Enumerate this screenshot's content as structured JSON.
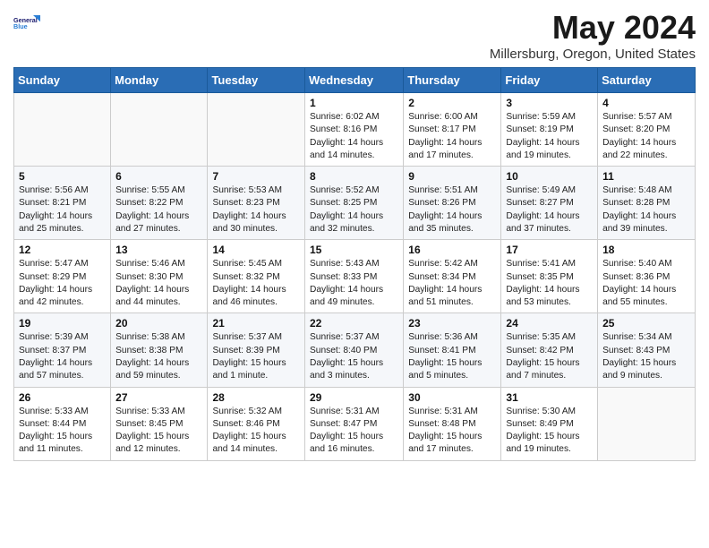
{
  "logo": {
    "line1": "General",
    "line2": "Blue"
  },
  "title": "May 2024",
  "location": "Millersburg, Oregon, United States",
  "days_of_week": [
    "Sunday",
    "Monday",
    "Tuesday",
    "Wednesday",
    "Thursday",
    "Friday",
    "Saturday"
  ],
  "weeks": [
    [
      {
        "day": "",
        "info": ""
      },
      {
        "day": "",
        "info": ""
      },
      {
        "day": "",
        "info": ""
      },
      {
        "day": "1",
        "sunrise": "6:02 AM",
        "sunset": "8:16 PM",
        "daylight": "14 hours and 14 minutes."
      },
      {
        "day": "2",
        "sunrise": "6:00 AM",
        "sunset": "8:17 PM",
        "daylight": "14 hours and 17 minutes."
      },
      {
        "day": "3",
        "sunrise": "5:59 AM",
        "sunset": "8:19 PM",
        "daylight": "14 hours and 19 minutes."
      },
      {
        "day": "4",
        "sunrise": "5:57 AM",
        "sunset": "8:20 PM",
        "daylight": "14 hours and 22 minutes."
      }
    ],
    [
      {
        "day": "5",
        "sunrise": "5:56 AM",
        "sunset": "8:21 PM",
        "daylight": "14 hours and 25 minutes."
      },
      {
        "day": "6",
        "sunrise": "5:55 AM",
        "sunset": "8:22 PM",
        "daylight": "14 hours and 27 minutes."
      },
      {
        "day": "7",
        "sunrise": "5:53 AM",
        "sunset": "8:23 PM",
        "daylight": "14 hours and 30 minutes."
      },
      {
        "day": "8",
        "sunrise": "5:52 AM",
        "sunset": "8:25 PM",
        "daylight": "14 hours and 32 minutes."
      },
      {
        "day": "9",
        "sunrise": "5:51 AM",
        "sunset": "8:26 PM",
        "daylight": "14 hours and 35 minutes."
      },
      {
        "day": "10",
        "sunrise": "5:49 AM",
        "sunset": "8:27 PM",
        "daylight": "14 hours and 37 minutes."
      },
      {
        "day": "11",
        "sunrise": "5:48 AM",
        "sunset": "8:28 PM",
        "daylight": "14 hours and 39 minutes."
      }
    ],
    [
      {
        "day": "12",
        "sunrise": "5:47 AM",
        "sunset": "8:29 PM",
        "daylight": "14 hours and 42 minutes."
      },
      {
        "day": "13",
        "sunrise": "5:46 AM",
        "sunset": "8:30 PM",
        "daylight": "14 hours and 44 minutes."
      },
      {
        "day": "14",
        "sunrise": "5:45 AM",
        "sunset": "8:32 PM",
        "daylight": "14 hours and 46 minutes."
      },
      {
        "day": "15",
        "sunrise": "5:43 AM",
        "sunset": "8:33 PM",
        "daylight": "14 hours and 49 minutes."
      },
      {
        "day": "16",
        "sunrise": "5:42 AM",
        "sunset": "8:34 PM",
        "daylight": "14 hours and 51 minutes."
      },
      {
        "day": "17",
        "sunrise": "5:41 AM",
        "sunset": "8:35 PM",
        "daylight": "14 hours and 53 minutes."
      },
      {
        "day": "18",
        "sunrise": "5:40 AM",
        "sunset": "8:36 PM",
        "daylight": "14 hours and 55 minutes."
      }
    ],
    [
      {
        "day": "19",
        "sunrise": "5:39 AM",
        "sunset": "8:37 PM",
        "daylight": "14 hours and 57 minutes."
      },
      {
        "day": "20",
        "sunrise": "5:38 AM",
        "sunset": "8:38 PM",
        "daylight": "14 hours and 59 minutes."
      },
      {
        "day": "21",
        "sunrise": "5:37 AM",
        "sunset": "8:39 PM",
        "daylight": "15 hours and 1 minute."
      },
      {
        "day": "22",
        "sunrise": "5:37 AM",
        "sunset": "8:40 PM",
        "daylight": "15 hours and 3 minutes."
      },
      {
        "day": "23",
        "sunrise": "5:36 AM",
        "sunset": "8:41 PM",
        "daylight": "15 hours and 5 minutes."
      },
      {
        "day": "24",
        "sunrise": "5:35 AM",
        "sunset": "8:42 PM",
        "daylight": "15 hours and 7 minutes."
      },
      {
        "day": "25",
        "sunrise": "5:34 AM",
        "sunset": "8:43 PM",
        "daylight": "15 hours and 9 minutes."
      }
    ],
    [
      {
        "day": "26",
        "sunrise": "5:33 AM",
        "sunset": "8:44 PM",
        "daylight": "15 hours and 11 minutes."
      },
      {
        "day": "27",
        "sunrise": "5:33 AM",
        "sunset": "8:45 PM",
        "daylight": "15 hours and 12 minutes."
      },
      {
        "day": "28",
        "sunrise": "5:32 AM",
        "sunset": "8:46 PM",
        "daylight": "15 hours and 14 minutes."
      },
      {
        "day": "29",
        "sunrise": "5:31 AM",
        "sunset": "8:47 PM",
        "daylight": "15 hours and 16 minutes."
      },
      {
        "day": "30",
        "sunrise": "5:31 AM",
        "sunset": "8:48 PM",
        "daylight": "15 hours and 17 minutes."
      },
      {
        "day": "31",
        "sunrise": "5:30 AM",
        "sunset": "8:49 PM",
        "daylight": "15 hours and 19 minutes."
      },
      {
        "day": "",
        "info": ""
      }
    ]
  ]
}
